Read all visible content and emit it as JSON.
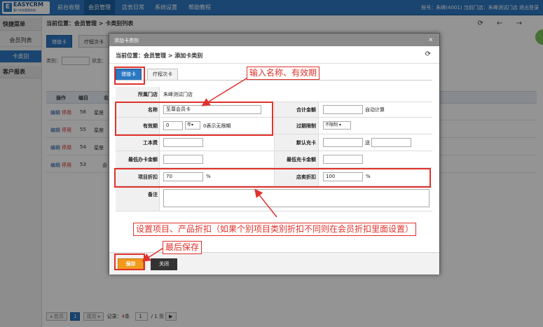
{
  "logo": {
    "mark": "E",
    "title": "EASYCRM",
    "subtitle": "客户关系管理系统"
  },
  "nav": [
    "前台收银",
    "会员管理",
    "店务日常",
    "系统设置",
    "帮助教程"
  ],
  "top_right": "账号：朱峰(4001)  当前门店：朱峰测试门店    退出登录",
  "sidebar": {
    "head1": "快捷菜单",
    "items": [
      "会员列表",
      "卡类别"
    ],
    "head2": "客户报表"
  },
  "breadcrumb": "当前位置：会员管理 > 卡类别列表",
  "toolbar_icons": "⟳ ← →",
  "page_tabs": [
    "储值卡",
    "疗程次卡"
  ],
  "filter": {
    "cat_label": "类别：",
    "status_label": "状态："
  },
  "table": {
    "headers": [
      "操作",
      "编目",
      "名"
    ],
    "rows": [
      {
        "edit": "编辑",
        "stop": "停用",
        "id": "56",
        "name": "星座"
      },
      {
        "edit": "编辑",
        "stop": "停用",
        "id": "55",
        "name": "星座"
      },
      {
        "edit": "编辑",
        "stop": "停用",
        "id": "54",
        "name": "星座"
      },
      {
        "edit": "编辑",
        "stop": "停用",
        "id": "53",
        "name": "会"
      }
    ]
  },
  "pager": {
    "first": "◂ 首页",
    "cur": "1",
    "last": "尾页 ▸",
    "records_label": "记录：",
    "records": "4",
    "unit": "条",
    "page_input": "1",
    "total": "/ 1 页",
    "go": "▶"
  },
  "modal": {
    "title": "添加卡类别",
    "close": "×",
    "crumb": "当前位置：会员管理 > 添加卡类别",
    "refresh": "⟳",
    "tabs": [
      "储值卡",
      "疗程次卡"
    ],
    "store_label": "所属门店",
    "store_value": "朱峰测试门店",
    "name_label": "名称",
    "name_value": "至尊会员卡",
    "total_label": "合计金额",
    "auto_calc": "自动计算",
    "validity_label": "有效期",
    "validity_value": "0",
    "validity_unit": "年▾",
    "validity_hint": "0表示无限期",
    "overdraft_label": "过期限制",
    "overdraft_value": "不限制 ▾",
    "cost_label": "工本费",
    "default_charge_label": "默认充卡",
    "send_label": "送",
    "min_open_label": "最低办卡金额",
    "min_charge_label": "最低充卡金额",
    "item_discount_label": "项目折扣",
    "item_discount_value": "70",
    "pct": "%",
    "sale_discount_label": "店卖折扣",
    "sale_discount_value": "100",
    "note_label": "备注",
    "save": "保存",
    "close_btn": "关闭"
  },
  "annotations": {
    "a1": "输入名称、有效期",
    "a2": "设置项目、产品折扣（如果个别项目类别折扣不同则在会员折扣里面设置）",
    "a3": "最后保存"
  },
  "colors": {
    "accent": "#2b78c2",
    "annotation": "#e0312b",
    "save": "#f39a1e"
  }
}
